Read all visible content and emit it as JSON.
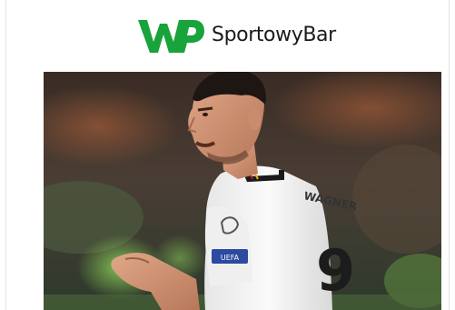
{
  "header": {
    "brand_name": "SportowyBar",
    "logo_letters": "WP"
  },
  "colors": {
    "logo_green": "#19a33b",
    "brand_text": "#1b1b1b",
    "jersey_white": "#f4f4f4",
    "jersey_number": "#1c1c1c"
  },
  "article": {
    "image_icon": "photo-icon",
    "jersey_name": "WAGNER",
    "jersey_number": "9",
    "sleeve_patch": "UEFA"
  }
}
